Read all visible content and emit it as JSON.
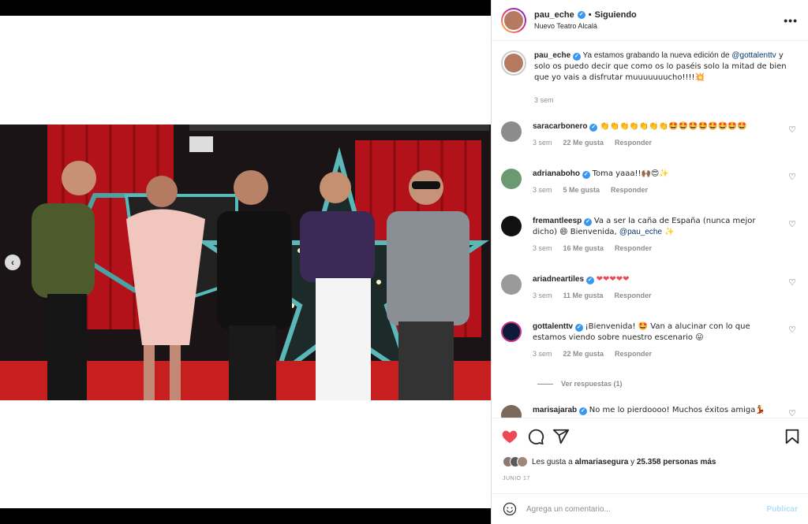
{
  "post": {
    "username": "pau_eche",
    "follow_status": "Siguiendo",
    "location": "Nuevo Teatro Alcalá",
    "caption_user": "pau_eche",
    "caption_pre": "Ya estamos grabando la nueva edición de ",
    "caption_mention": "@gottalenttv",
    "caption_post": " y solo os puedo decir que como os lo paséis solo la mitad de bien que yo vais a disfrutar muuuuuuucho!!!!💥",
    "caption_time": "3 sem"
  },
  "comments": [
    {
      "user": "saracarbonero",
      "text": "👏👏👏👏👏👏👏🤩🤩🤩🤩🤩🤩🤩🤩",
      "time": "3 sem",
      "likes": "22 Me gusta",
      "reply": "Responder"
    },
    {
      "user": "adrianaboho",
      "text": "Toma yaaa!!🙌🏾😍✨",
      "time": "3 sem",
      "likes": "5 Me gusta",
      "reply": "Responder"
    },
    {
      "user": "fremantleesp",
      "text_pre": "Va a ser la caña de España (nunca mejor dicho) 😄 Bienvenida, ",
      "mention": "@pau_eche",
      "text_post": " ✨",
      "time": "3 sem",
      "likes": "16 Me gusta",
      "reply": "Responder"
    },
    {
      "user": "ariadneartiles",
      "text": "❤❤❤❤❤",
      "time": "3 sem",
      "likes": "11 Me gusta",
      "reply": "Responder"
    },
    {
      "user": "gottalenttv",
      "text": "¡Bienvenida! 🤩 Van a alucinar con lo que estamos viendo sobre nuestro escenario 😛",
      "time": "3 sem",
      "likes": "22 Me gusta",
      "reply": "Responder",
      "view_replies": "Ver respuestas (1)"
    },
    {
      "user": "marisajarab",
      "text": "No me lo pierdoooo! Muchos éxitos amiga💃"
    }
  ],
  "likes": {
    "pre": "Les gusta a ",
    "user": "almariasegura",
    "mid": " y ",
    "count": "25.358 personas más"
  },
  "date": "JUNIO 17",
  "comment_box": {
    "placeholder": "Agrega un comentario...",
    "publish": "Publicar"
  },
  "colors": {
    "liked_heart": "#ed4956",
    "verified": "#3897f0",
    "mention": "#00376b",
    "publish_disabled": "#b2dffc"
  },
  "icons": {
    "carousel_prev": "chevron-left-icon",
    "more": "more-options-icon",
    "like": "heart-icon",
    "comment": "comment-icon",
    "share": "share-icon",
    "save": "bookmark-icon",
    "emoji": "emoji-icon"
  }
}
